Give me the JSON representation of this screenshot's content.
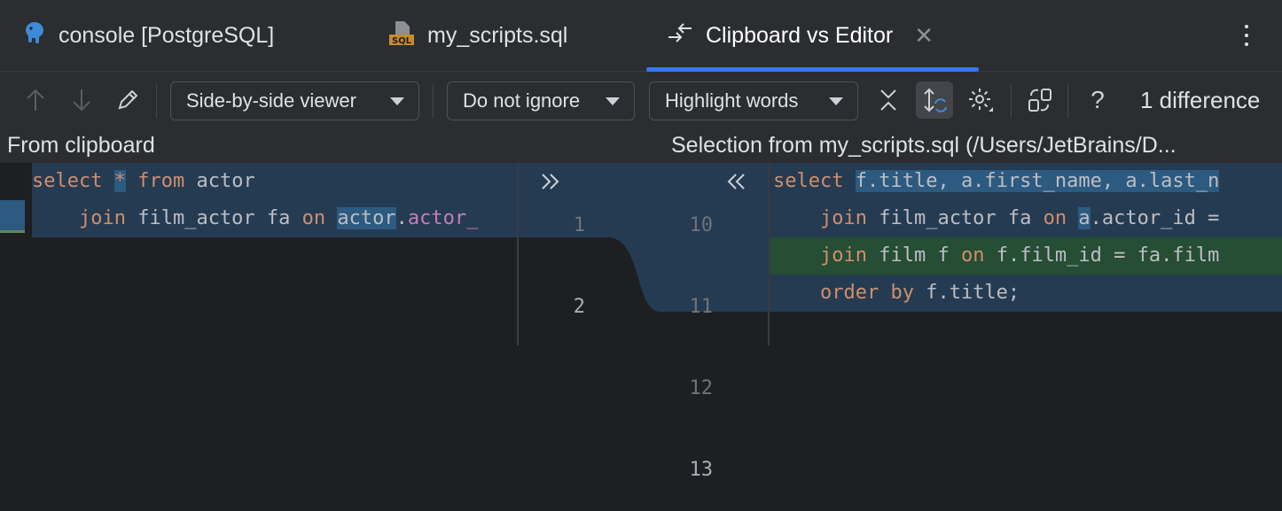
{
  "tabs": [
    {
      "label": "console [PostgreSQL]",
      "icon": "postgresql-elephant-icon"
    },
    {
      "label": "my_scripts.sql",
      "icon": "sql-file-icon"
    },
    {
      "label": "Clipboard vs Editor",
      "icon": "compare-arrows-icon",
      "active": true
    }
  ],
  "toolbar": {
    "viewer": "Side-by-side viewer",
    "ignore": "Do not ignore",
    "highlight": "Highlight words",
    "help": "?",
    "difference_count": "1 difference"
  },
  "panes": {
    "left_title": "From clipboard",
    "right_title": "Selection from my_scripts.sql (/Users/JetBrains/D..."
  },
  "left_code": {
    "l1": {
      "kw1": "select",
      "star": "*",
      "kw2": "from",
      "t1": "actor"
    },
    "l2": {
      "kw1": "join",
      "t1": "film_actor fa",
      "kw2": "on",
      "t2": "actor",
      "t3": ".",
      "t4": "actor_"
    }
  },
  "gutter": {
    "left_numbers": [
      "1",
      "2"
    ],
    "right_numbers": [
      "10",
      "11",
      "12",
      "13"
    ]
  },
  "right_code": {
    "l1": {
      "kw1": "select",
      "t1": "f.title, a.first_name, a.last_n"
    },
    "l2": {
      "kw1": "join",
      "t1": "film_actor fa",
      "kw2": "on",
      "t2": "a",
      "t3": ".actor_id ="
    },
    "l3": {
      "kw1": "join",
      "t1": "film f",
      "kw2": "on",
      "t2": "f.film_id = fa.film"
    },
    "l4": {
      "kw1": "order by",
      "t1": "f.title",
      "t2": ";"
    }
  },
  "colors": {
    "accent": "#3574f0",
    "changed": "#2c5a80",
    "inserted": "#254e34",
    "keyword": "#cf8e6d"
  }
}
